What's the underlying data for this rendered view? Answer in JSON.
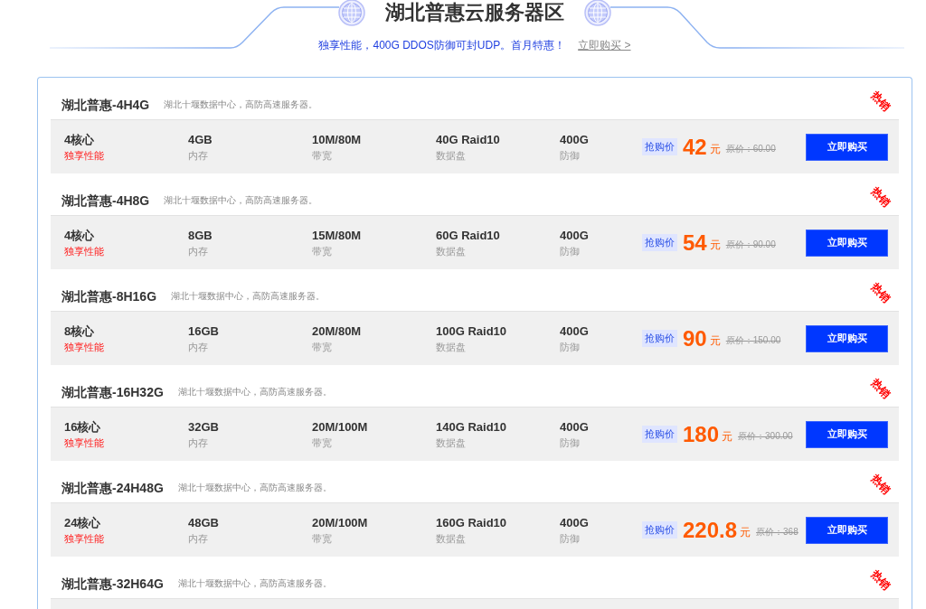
{
  "header": {
    "title": "湖北普惠云服务器区",
    "subtitle": "独享性能，400G DDOS防御可封UDP。首月特惠！",
    "link": "立即购买 >"
  },
  "products": [
    {
      "name": "湖北普惠-4H4G",
      "description": "湖北十堰数据中心，高防高速服务器。",
      "badge": "热销",
      "specs": [
        {
          "value": "4核心",
          "label": "独享性能",
          "highlighted": true
        },
        {
          "value": "4GB",
          "label": "内存",
          "highlighted": false
        },
        {
          "value": "10M/80M",
          "label": "带宽",
          "highlighted": false
        },
        {
          "value": "40G Raid10",
          "label": "数据盘",
          "highlighted": false
        },
        {
          "value": "400G",
          "label": "防御",
          "highlighted": false
        }
      ],
      "price": {
        "tag": "抢购价",
        "amount": "42",
        "unit": "元",
        "original": "原价：60.00"
      },
      "button": "立即购买"
    },
    {
      "name": "湖北普惠-4H8G",
      "description": "湖北十堰数据中心，高防高速服务器。",
      "badge": "热销",
      "specs": [
        {
          "value": "4核心",
          "label": "独享性能",
          "highlighted": true
        },
        {
          "value": "8GB",
          "label": "内存",
          "highlighted": false
        },
        {
          "value": "15M/80M",
          "label": "带宽",
          "highlighted": false
        },
        {
          "value": "60G Raid10",
          "label": "数据盘",
          "highlighted": false
        },
        {
          "value": "400G",
          "label": "防御",
          "highlighted": false
        }
      ],
      "price": {
        "tag": "抢购价",
        "amount": "54",
        "unit": "元",
        "original": "原价：90.00"
      },
      "button": "立即购买"
    },
    {
      "name": "湖北普惠-8H16G",
      "description": "湖北十堰数据中心，高防高速服务器。",
      "badge": "热销",
      "specs": [
        {
          "value": "8核心",
          "label": "独享性能",
          "highlighted": true
        },
        {
          "value": "16GB",
          "label": "内存",
          "highlighted": false
        },
        {
          "value": "20M/80M",
          "label": "带宽",
          "highlighted": false
        },
        {
          "value": "100G Raid10",
          "label": "数据盘",
          "highlighted": false
        },
        {
          "value": "400G",
          "label": "防御",
          "highlighted": false
        }
      ],
      "price": {
        "tag": "抢购价",
        "amount": "90",
        "unit": "元",
        "original": "原价：150.00"
      },
      "button": "立即购买"
    },
    {
      "name": "湖北普惠-16H32G",
      "description": "湖北十堰数据中心，高防高速服务器。",
      "badge": "热销",
      "specs": [
        {
          "value": "16核心",
          "label": "独享性能",
          "highlighted": true
        },
        {
          "value": "32GB",
          "label": "内存",
          "highlighted": false
        },
        {
          "value": "20M/100M",
          "label": "带宽",
          "highlighted": false
        },
        {
          "value": "140G Raid10",
          "label": "数据盘",
          "highlighted": false
        },
        {
          "value": "400G",
          "label": "防御",
          "highlighted": false
        }
      ],
      "price": {
        "tag": "抢购价",
        "amount": "180",
        "unit": "元",
        "original": "原价：300.00"
      },
      "button": "立即购买"
    },
    {
      "name": "湖北普惠-24H48G",
      "description": "湖北十堰数据中心，高防高速服务器。",
      "badge": "热销",
      "specs": [
        {
          "value": "24核心",
          "label": "独享性能",
          "highlighted": true
        },
        {
          "value": "48GB",
          "label": "内存",
          "highlighted": false
        },
        {
          "value": "20M/100M",
          "label": "带宽",
          "highlighted": false
        },
        {
          "value": "160G Raid10",
          "label": "数据盘",
          "highlighted": false
        },
        {
          "value": "400G",
          "label": "防御",
          "highlighted": false
        }
      ],
      "price": {
        "tag": "抢购价",
        "amount": "220.8",
        "unit": "元",
        "original": "原价：368"
      },
      "button": "立即购买"
    },
    {
      "name": "湖北普惠-32H64G",
      "description": "湖北十堰数据中心，高防高速服务器。",
      "badge": "热销"
    }
  ]
}
